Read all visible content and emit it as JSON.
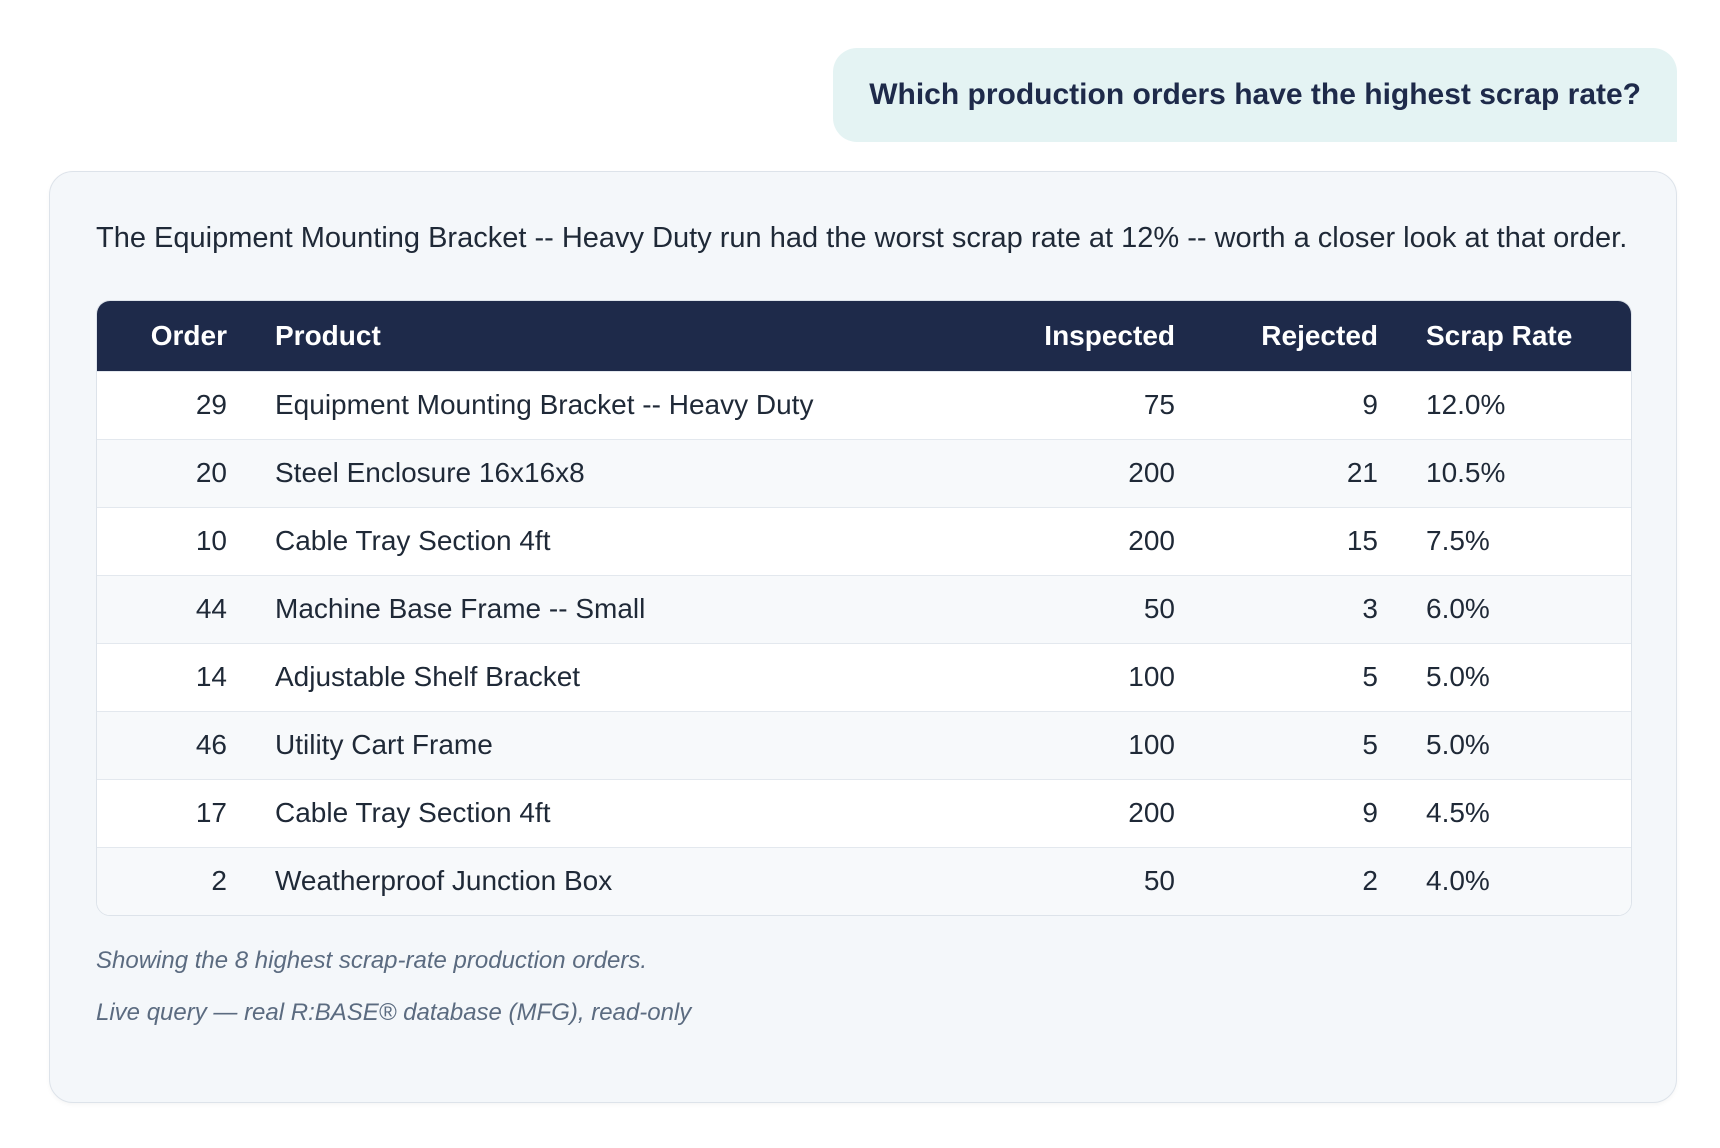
{
  "user_message": "Which production orders have the highest scrap rate?",
  "answer": {
    "text": "The Equipment Mounting Bracket -- Heavy Duty run had the worst scrap rate at 12% -- worth a closer look at that order.",
    "table": {
      "headers": {
        "order": "Order",
        "product": "Product",
        "inspected": "Inspected",
        "rejected": "Rejected",
        "scrap_rate": "Scrap Rate"
      },
      "rows": [
        {
          "order": "29",
          "product": "Equipment Mounting Bracket -- Heavy Duty",
          "inspected": "75",
          "rejected": "9",
          "scrap_rate": "12.0%"
        },
        {
          "order": "20",
          "product": "Steel Enclosure 16x16x8",
          "inspected": "200",
          "rejected": "21",
          "scrap_rate": "10.5%"
        },
        {
          "order": "10",
          "product": "Cable Tray Section 4ft",
          "inspected": "200",
          "rejected": "15",
          "scrap_rate": "7.5%"
        },
        {
          "order": "44",
          "product": "Machine Base Frame -- Small",
          "inspected": "50",
          "rejected": "3",
          "scrap_rate": "6.0%"
        },
        {
          "order": "14",
          "product": "Adjustable Shelf Bracket",
          "inspected": "100",
          "rejected": "5",
          "scrap_rate": "5.0%"
        },
        {
          "order": "46",
          "product": "Utility Cart Frame",
          "inspected": "100",
          "rejected": "5",
          "scrap_rate": "5.0%"
        },
        {
          "order": "17",
          "product": "Cable Tray Section 4ft",
          "inspected": "200",
          "rejected": "9",
          "scrap_rate": "4.5%"
        },
        {
          "order": "2",
          "product": "Weatherproof Junction Box",
          "inspected": "50",
          "rejected": "2",
          "scrap_rate": "4.0%"
        }
      ]
    },
    "footnote_count": "Showing the 8 highest scrap-rate production orders.",
    "footnote_source": "Live query — real R:BASE® database (MFG), read-only"
  },
  "colors": {
    "header_bg": "#1e2a4a",
    "user_bubble_bg": "#e4f3f3",
    "card_bg": "#f4f7fa"
  }
}
